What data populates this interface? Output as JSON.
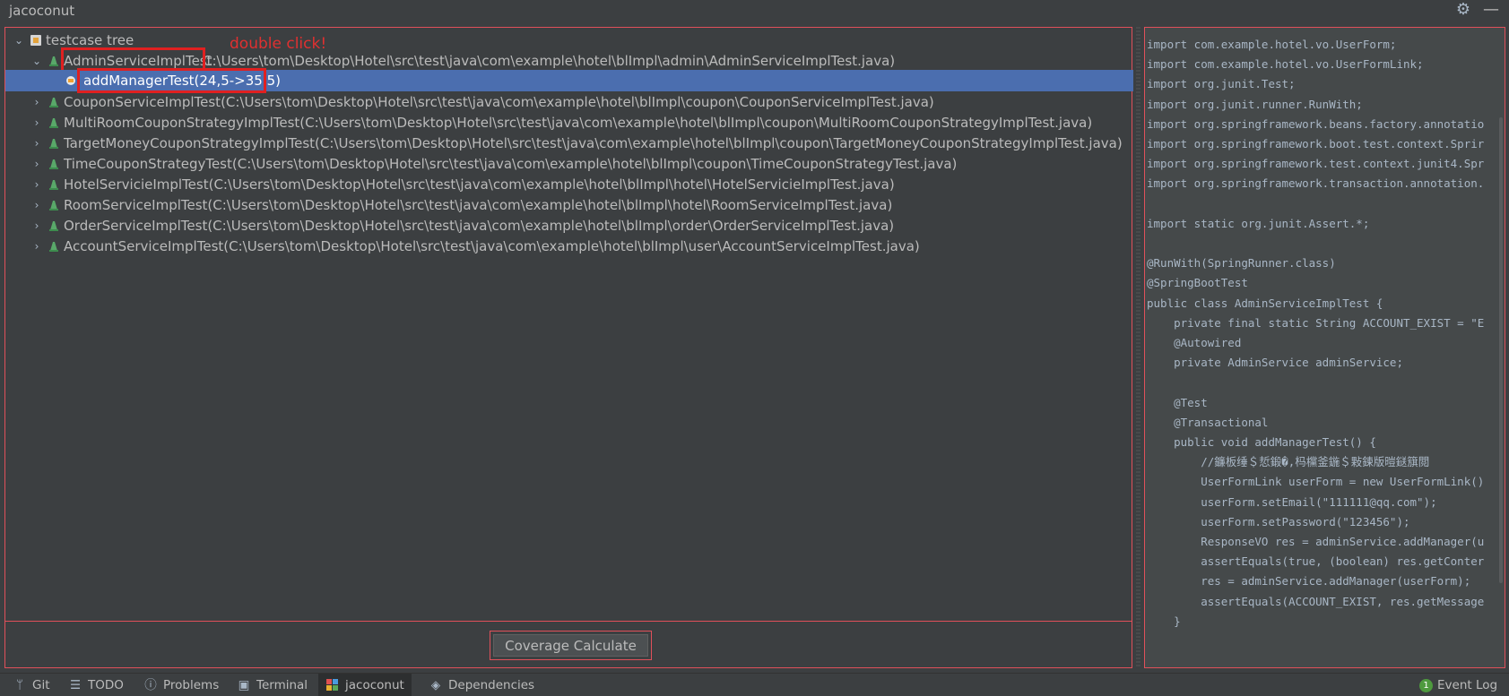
{
  "window": {
    "title": "jacoconut",
    "settings_icon": "gear-icon",
    "minimize_icon": "minimize-icon"
  },
  "tree": {
    "root_label": "testcase tree",
    "annotation": "double click!",
    "expanded_node": {
      "name": "AdminServiceImplTest",
      "path": " C:\\Users\\tom\\Desktop\\Hotel\\src\\test\\java\\com\\example\\hotel\\blImpl\\admin\\AdminServiceImplTest.java)"
    },
    "selected_method": "addManagerTest(24,5->35,5)",
    "nodes": [
      "CouponServiceImplTest(C:\\Users\\tom\\Desktop\\Hotel\\src\\test\\java\\com\\example\\hotel\\blImpl\\coupon\\CouponServiceImplTest.java)",
      "MultiRoomCouponStrategyImplTest(C:\\Users\\tom\\Desktop\\Hotel\\src\\test\\java\\com\\example\\hotel\\blImpl\\coupon\\MultiRoomCouponStrategyImplTest.java)",
      "TargetMoneyCouponStrategyImplTest(C:\\Users\\tom\\Desktop\\Hotel\\src\\test\\java\\com\\example\\hotel\\blImpl\\coupon\\TargetMoneyCouponStrategyImplTest.java)",
      "TimeCouponStrategyTest(C:\\Users\\tom\\Desktop\\Hotel\\src\\test\\java\\com\\example\\hotel\\blImpl\\coupon\\TimeCouponStrategyTest.java)",
      "HotelServicieImplTest(C:\\Users\\tom\\Desktop\\Hotel\\src\\test\\java\\com\\example\\hotel\\blImpl\\hotel\\HotelServicieImplTest.java)",
      "RoomServiceImplTest(C:\\Users\\tom\\Desktop\\Hotel\\src\\test\\java\\com\\example\\hotel\\blImpl\\hotel\\RoomServiceImplTest.java)",
      "OrderServiceImplTest(C:\\Users\\tom\\Desktop\\Hotel\\src\\test\\java\\com\\example\\hotel\\blImpl\\order\\OrderServiceImplTest.java)",
      "AccountServiceImplTest(C:\\Users\\tom\\Desktop\\Hotel\\src\\test\\java\\com\\example\\hotel\\blImpl\\user\\AccountServiceImplTest.java)"
    ]
  },
  "coverage_button": "Coverage Calculate",
  "code_lines": [
    "import com.example.hotel.vo.UserForm;",
    "import com.example.hotel.vo.UserFormLink;",
    "import org.junit.Test;",
    "import org.junit.runner.RunWith;",
    "import org.springframework.beans.factory.annotatio",
    "import org.springframework.boot.test.context.Sprir",
    "import org.springframework.test.context.junit4.Spr",
    "import org.springframework.transaction.annotation.",
    "",
    "import static org.junit.Assert.*;",
    "",
    "@RunWith(SpringRunner.class)",
    "@SpringBootTest",
    "public class AdminServiceImplTest {",
    "    private final static String ACCOUNT_EXIST = \"E",
    "    @Autowired",
    "    private AdminService adminService;",
    "",
    "    @Test",
    "    @Transactional",
    "    public void addManagerTest() {",
    "        //鐮板缍＄悊鍛�,杩欓釜鍦＄敤鍊版暟鎹簱閲",
    "        UserFormLink userForm = new UserFormLink()",
    "        userForm.setEmail(\"111111@qq.com\");",
    "        userForm.setPassword(\"123456\");",
    "        ResponseVO res = adminService.addManager(u",
    "        assertEquals(true, (boolean) res.getConter",
    "        res = adminService.addManager(userForm);",
    "        assertEquals(ACCOUNT_EXIST, res.getMessage",
    "    }"
  ],
  "bottom_tabs": [
    {
      "label": "Git",
      "icon": "git-branch-icon"
    },
    {
      "label": "TODO",
      "icon": "list-icon"
    },
    {
      "label": "Problems",
      "icon": "info-icon"
    },
    {
      "label": "Terminal",
      "icon": "terminal-icon"
    },
    {
      "label": "jacoconut",
      "icon": "jacoconut-icon"
    },
    {
      "label": "Dependencies",
      "icon": "layers-icon"
    }
  ],
  "event_log": {
    "label": "Event Log",
    "count": "1"
  }
}
